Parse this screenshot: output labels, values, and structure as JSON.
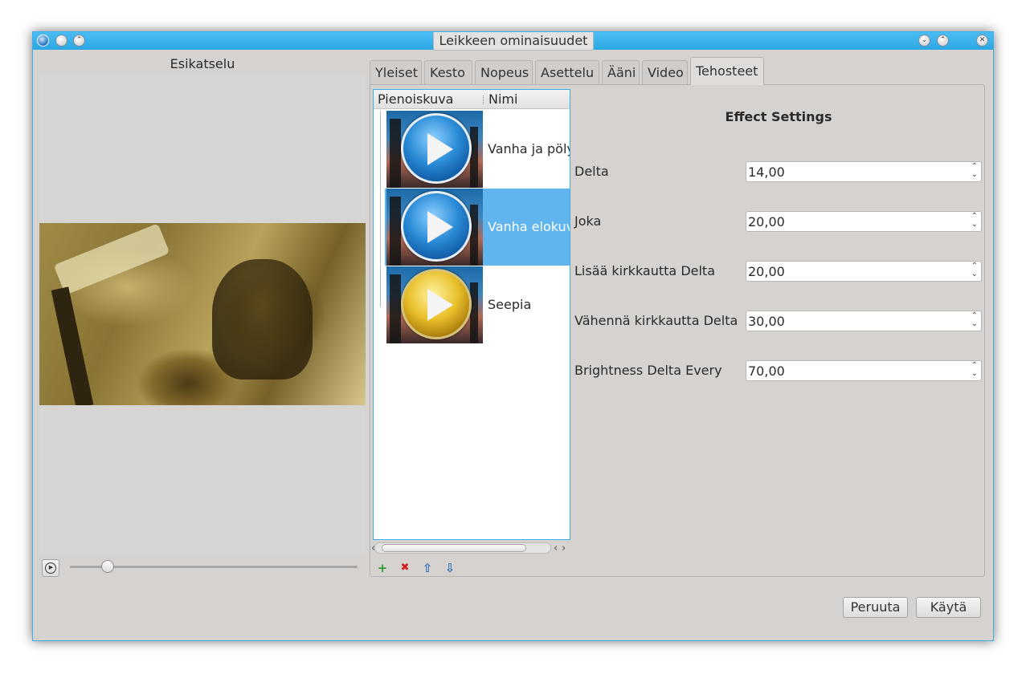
{
  "window": {
    "title": "Leikkeen ominaisuudet"
  },
  "preview": {
    "label": "Esikatselu",
    "seek_value": 0.13
  },
  "tabs": [
    {
      "label": "Yleiset"
    },
    {
      "label": "Kesto"
    },
    {
      "label": "Nopeus"
    },
    {
      "label": "Asettelu"
    },
    {
      "label": "Ääni"
    },
    {
      "label": "Video"
    },
    {
      "label": "Tehosteet",
      "active": true
    }
  ],
  "effects_list": {
    "columns": [
      "Pienoiskuva",
      "Nimi"
    ],
    "items": [
      {
        "name": "Vanha ja pölyinen",
        "icon": "blue-play-orb-icon"
      },
      {
        "name": "Vanha elokuva",
        "icon": "blue-play-orb-icon",
        "selected": true
      },
      {
        "name": "Seepia",
        "icon": "gold-play-orb-icon"
      }
    ],
    "tools": {
      "add": "+",
      "remove": "✖",
      "up": "⇧",
      "down": "⇩"
    }
  },
  "settings": {
    "title": "Effect Settings",
    "fields": [
      {
        "label": "Delta",
        "value": "14,00"
      },
      {
        "label": "Joka",
        "value": "20,00"
      },
      {
        "label": "Lisää kirkkautta Delta",
        "value": "20,00"
      },
      {
        "label": "Vähennä kirkkautta Delta",
        "value": "30,00"
      },
      {
        "label": "Brightness Delta Every",
        "value": "70,00"
      }
    ]
  },
  "buttons": {
    "cancel": "Peruuta",
    "apply": "Käytä"
  },
  "colors": {
    "accent": "#3daee9",
    "selection": "#61b5ef",
    "window_bg": "#d6d2d0"
  }
}
